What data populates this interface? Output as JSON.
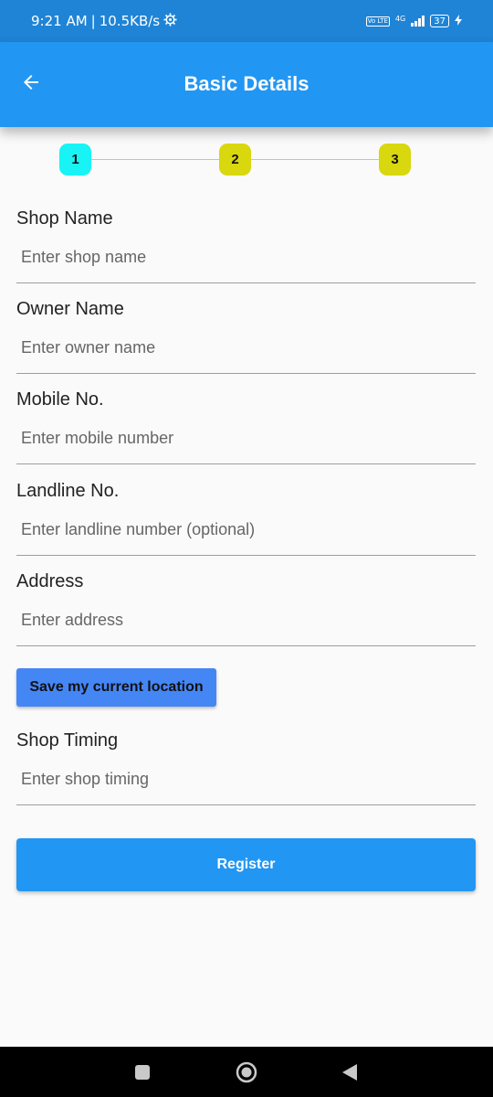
{
  "status_bar": {
    "time": "9:21 AM",
    "separator": "|",
    "speed": "10.5KB/s",
    "volte": "Vo LTE",
    "network": "4G",
    "battery": "37"
  },
  "app_bar": {
    "title": "Basic Details",
    "back_icon": "arrow-left-icon"
  },
  "stepper": {
    "steps": [
      {
        "number": "1",
        "color": "#18f3f6"
      },
      {
        "number": "2",
        "color": "#d9d70e"
      },
      {
        "number": "3",
        "color": "#d9d70e"
      }
    ],
    "line_color": "#d8d61a"
  },
  "form": {
    "shop_name": {
      "label": "Shop Name",
      "placeholder": "Enter shop name",
      "value": ""
    },
    "owner_name": {
      "label": "Owner Name",
      "placeholder": "Enter owner name",
      "value": ""
    },
    "mobile": {
      "label": "Mobile No.",
      "placeholder": "Enter mobile number",
      "value": ""
    },
    "landline": {
      "label": "Landline No.",
      "placeholder": "Enter landline number (optional)",
      "value": ""
    },
    "address": {
      "label": "Address",
      "placeholder": "Enter address",
      "value": ""
    },
    "save_location_label": "Save my current location",
    "shop_timing": {
      "label": "Shop Timing",
      "placeholder": "Enter shop timing",
      "value": ""
    },
    "register_label": "Register"
  },
  "colors": {
    "primary": "#2296f3",
    "status_bar": "#1f84d6",
    "location_button": "#4586f5"
  },
  "nav_bar": {
    "recents_icon": "square-icon",
    "home_icon": "circle-home-icon",
    "back_icon": "triangle-back-icon"
  }
}
